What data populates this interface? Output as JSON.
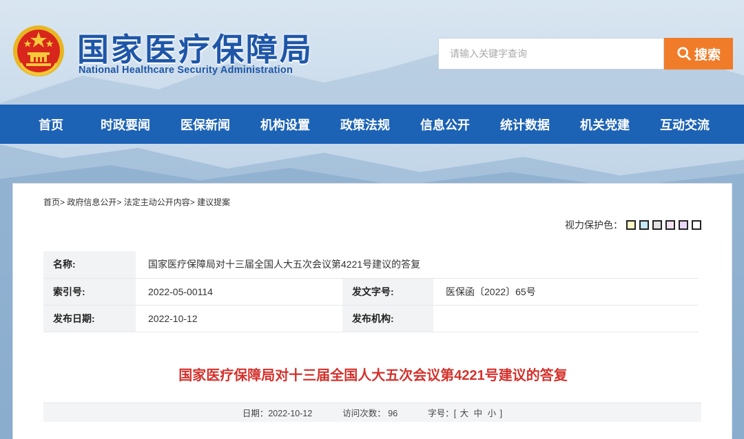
{
  "header": {
    "title": "国家医疗保障局",
    "subtitle": "National Healthcare Security Administration"
  },
  "search": {
    "placeholder": "请输入关键字查询",
    "button_label": "搜索"
  },
  "nav": {
    "items": [
      "首页",
      "时政要闻",
      "医保新闻",
      "机构设置",
      "政策法规",
      "信息公开",
      "统计数据",
      "机关党建",
      "互动交流"
    ]
  },
  "breadcrumb": {
    "items": [
      "首页",
      "政府信息公开",
      "法定主动公开内容",
      "建议提案"
    ],
    "separator": ">"
  },
  "color_protect": {
    "label": "视力保护色：",
    "swatches": [
      "#fdf7c4",
      "#c5e9f5",
      "#e2e2e2",
      "#f3e3f1",
      "#e9d7f7",
      "#ffffff"
    ]
  },
  "info": {
    "name_label": "名称:",
    "name_value": "国家医疗保障局对十三届全国人大五次会议第4221号建议的答复",
    "index_label": "索引号:",
    "index_value": "2022-05-00114",
    "doc_no_label": "发文字号:",
    "doc_no_value": "医保函〔2022〕65号",
    "date_label": "发布日期:",
    "date_value": "2022-10-12",
    "org_label": "发布机构:",
    "org_value": ""
  },
  "document": {
    "title": "国家医疗保障局对十三届全国人大五次会议第4221号建议的答复"
  },
  "meta": {
    "date": "日期：2022-10-12",
    "visits": "访问次数：  96",
    "font_label": "字号：[",
    "font_large": "大",
    "font_medium": "中",
    "font_small": "小",
    "font_end": "]"
  },
  "colors": {
    "brand_blue": "#1e56a8",
    "nav_blue": "#1c62b5",
    "search_orange": "#f07c29",
    "title_red": "#d4312c"
  }
}
